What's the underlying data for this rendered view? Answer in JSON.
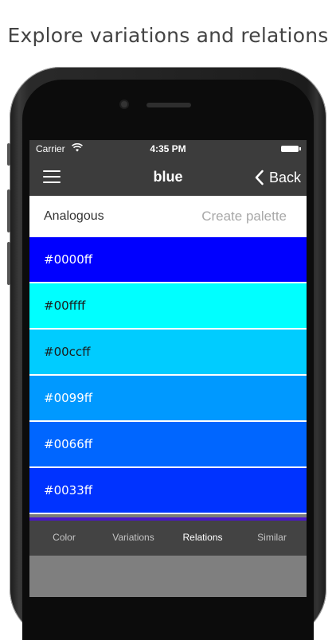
{
  "caption": "Explore variations and relations",
  "status": {
    "carrier": "Carrier",
    "time": "4:35 PM"
  },
  "nav": {
    "title": "blue",
    "back_label": "Back",
    "menu_icon": "hamburger-menu-icon",
    "back_icon": "chevron-left-icon"
  },
  "subheader": {
    "title": "Analogous",
    "action": "Create palette"
  },
  "swatches": [
    {
      "label": "#0000ff",
      "color": "#0000ff",
      "text_color": "#ffffff"
    },
    {
      "label": "#00ffff",
      "color": "#00ffff",
      "text_color": "#1a1a1a"
    },
    {
      "label": "#00ccff",
      "color": "#00ccff",
      "text_color": "#1a1a1a"
    },
    {
      "label": "#0099ff",
      "color": "#0099ff",
      "text_color": "#ffffff"
    },
    {
      "label": "#0066ff",
      "color": "#0066ff",
      "text_color": "#ffffff"
    },
    {
      "label": "#0033ff",
      "color": "#0033ff",
      "text_color": "#ffffff"
    }
  ],
  "strip_color": "#4a17c8",
  "tabs": [
    {
      "label": "Color",
      "active": false
    },
    {
      "label": "Variations",
      "active": false
    },
    {
      "label": "Relations",
      "active": true
    },
    {
      "label": "Similar",
      "active": false
    }
  ]
}
